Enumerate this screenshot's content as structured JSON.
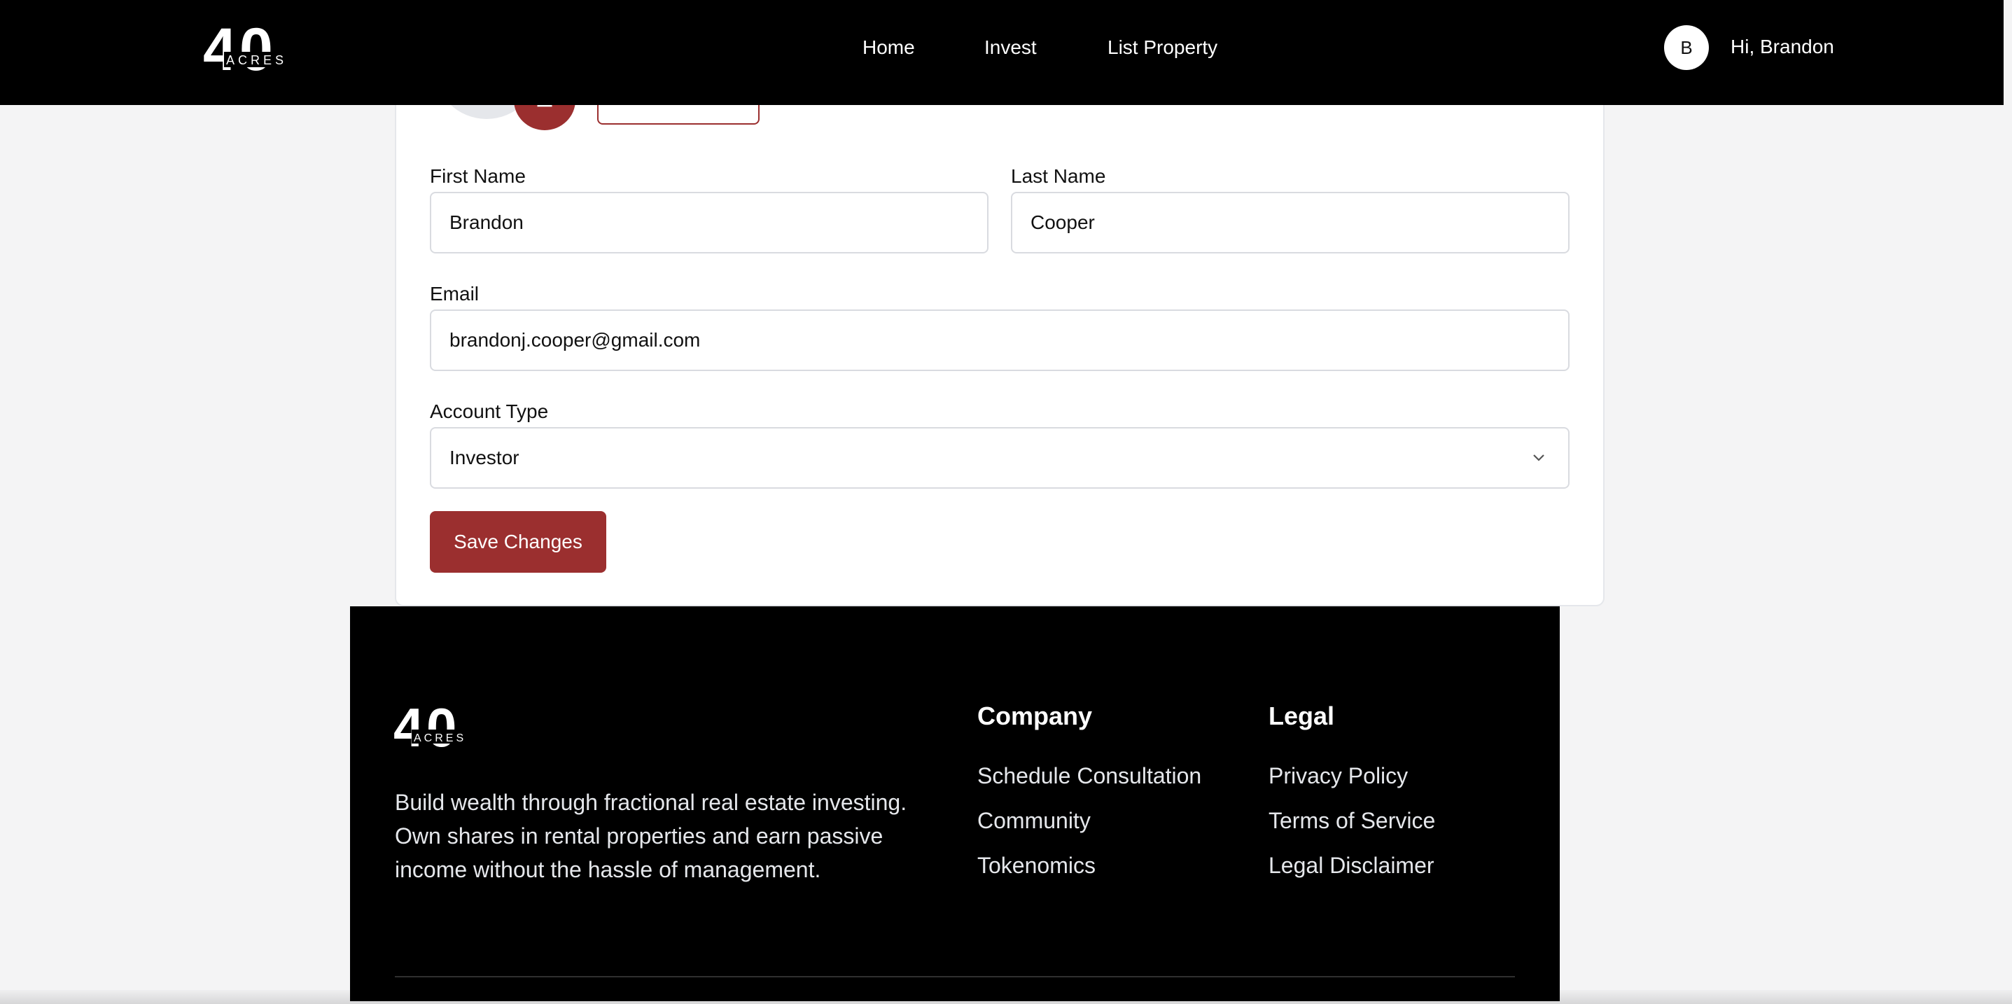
{
  "header": {
    "logo_text": "40 ACRES",
    "nav": [
      {
        "label": "Home"
      },
      {
        "label": "Invest"
      },
      {
        "label": "List Property"
      }
    ],
    "avatar_initial": "B",
    "greeting": "Hi, Brandon"
  },
  "form": {
    "first_name_label": "First Name",
    "first_name_value": "Brandon",
    "last_name_label": "Last Name",
    "last_name_value": "Cooper",
    "email_label": "Email",
    "email_value": "brandonj.cooper@gmail.com",
    "account_type_label": "Account Type",
    "account_type_value": "Investor",
    "save_label": "Save Changes"
  },
  "footer": {
    "logo_text": "40 ACRES",
    "description": "Build wealth through fractional real estate investing. Own shares in rental properties and earn passive income without the hassle of management.",
    "company_heading": "Company",
    "company_links": [
      "Schedule Consultation",
      "Community",
      "Tokenomics"
    ],
    "legal_heading": "Legal",
    "legal_links": [
      "Privacy Policy",
      "Terms of Service",
      "Legal Disclaimer"
    ]
  },
  "colors": {
    "brand": "#9b2f2f",
    "header_bg": "#000000",
    "page_bg": "#f4f4f5"
  },
  "icons": {
    "dropdown": "chevron-down-icon",
    "avatar_edit": "camera-icon"
  }
}
